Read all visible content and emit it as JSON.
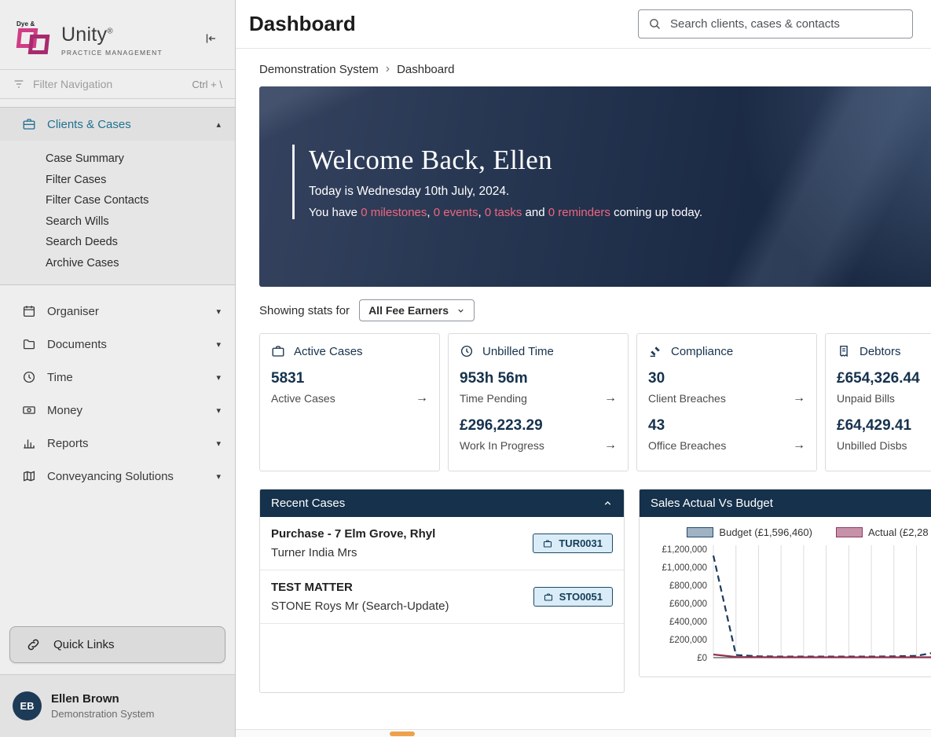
{
  "colors": {
    "accent_pink": "#f0657e",
    "panel_header_navy": "#15314b",
    "stat_navy": "#16324d",
    "active_nav_teal": "#1f7191",
    "badge_bg": "#d9ecf7",
    "badge_border": "#1d4a66",
    "brand_pink": "#cf3d85"
  },
  "icons": {
    "chevron_collapsed": "▾",
    "chevron_expanded": "▴",
    "metric_arrow": "→",
    "breadcrumb_separator": "›"
  },
  "sidebar": {
    "brand": {
      "mark_text": "Dye &",
      "name": "Unity",
      "reg": "®",
      "tagline": "PRACTICE MANAGEMENT"
    },
    "filter": {
      "placeholder": "Filter Navigation",
      "shortcut": "Ctrl + \\"
    },
    "sections": [
      {
        "label": "Clients & Cases",
        "expanded": true,
        "items": [
          "Case Summary",
          "Filter Cases",
          "Filter Case Contacts",
          "Search Wills",
          "Search Deeds",
          "Archive Cases"
        ]
      },
      {
        "label": "Organiser"
      },
      {
        "label": "Documents"
      },
      {
        "label": "Time"
      },
      {
        "label": "Money"
      },
      {
        "label": "Reports"
      },
      {
        "label": "Conveyancing Solutions"
      }
    ],
    "quick_links_label": "Quick Links",
    "user": {
      "initials": "EB",
      "name": "Ellen Brown",
      "org": "Demonstration System"
    }
  },
  "header": {
    "title": "Dashboard",
    "search_placeholder": "Search clients, cases & contacts"
  },
  "breadcrumb": {
    "root": "Demonstration System",
    "current": "Dashboard"
  },
  "hero": {
    "title": "Welcome Back, Ellen",
    "date": "Today is Wednesday 10th July, 2024.",
    "summary": [
      "You have ",
      "0 milestones",
      ", ",
      "0 events",
      ", ",
      "0 tasks",
      " and ",
      "0 reminders",
      " coming up today."
    ]
  },
  "stats_bar": {
    "label": "Showing stats for",
    "selected": "All Fee Earners"
  },
  "cards": [
    {
      "title": "Active Cases",
      "icon": "briefcase-icon",
      "metrics": [
        {
          "value": "5831",
          "label": "Active Cases"
        }
      ]
    },
    {
      "title": "Unbilled Time",
      "icon": "clock-icon",
      "metrics": [
        {
          "value": "953h 56m",
          "label": "Time Pending"
        },
        {
          "value": "£296,223.29",
          "label": "Work In Progress"
        }
      ]
    },
    {
      "title": "Compliance",
      "icon": "gavel-icon",
      "metrics": [
        {
          "value": "30",
          "label": "Client Breaches"
        },
        {
          "value": "43",
          "label": "Office Breaches"
        }
      ]
    },
    {
      "title": "Debtors",
      "icon": "invoice-icon",
      "metrics": [
        {
          "value": "£654,326.44",
          "label": "Unpaid Bills"
        },
        {
          "value": "£64,429.41",
          "label": "Unbilled Disbs"
        }
      ]
    }
  ],
  "recent_cases": {
    "title": "Recent Cases",
    "rows": [
      {
        "title": "Purchase - 7 Elm Grove, Rhyl",
        "subtitle": "Turner India Mrs",
        "badge": "TUR0031"
      },
      {
        "title": "TEST MATTER",
        "subtitle": "STONE Roys Mr (Search-Update)",
        "badge": "STO0051"
      }
    ]
  },
  "sales": {
    "title": "Sales Actual Vs Budget",
    "legend": [
      {
        "label": "Budget (£1,596,460)",
        "fill": "#9fb3c4",
        "border": "#27486a"
      },
      {
        "label": "Actual (£2,28",
        "fill": "#c792a9",
        "border": "#8d3a5e"
      }
    ]
  },
  "chart_data": {
    "type": "line",
    "title": "Sales Actual Vs Budget",
    "x_count": 12,
    "categories": [],
    "series": [
      {
        "name": "Budget (£1,596,460)",
        "color": "#1d3b5e",
        "dash": true,
        "values": [
          1130000,
          30000,
          15000,
          12000,
          12000,
          12000,
          12000,
          12000,
          15000,
          20000,
          65000,
          70000
        ]
      },
      {
        "name": "Actual (£2,28",
        "color": "#93314f",
        "dash": false,
        "values": [
          35000,
          8000,
          5000,
          4000,
          4000,
          4000,
          4000,
          4000,
          4000,
          4000,
          4000,
          4000
        ]
      }
    ],
    "ylim": [
      0,
      1200000
    ],
    "yticks": [
      0,
      200000,
      400000,
      600000,
      800000,
      1000000,
      1200000
    ],
    "ytick_labels": [
      "£0",
      "£200,000",
      "£400,000",
      "£600,000",
      "£800,000",
      "£1,000,000",
      "£1,200,000"
    ],
    "grid": "vertical",
    "legend_position": "top"
  }
}
